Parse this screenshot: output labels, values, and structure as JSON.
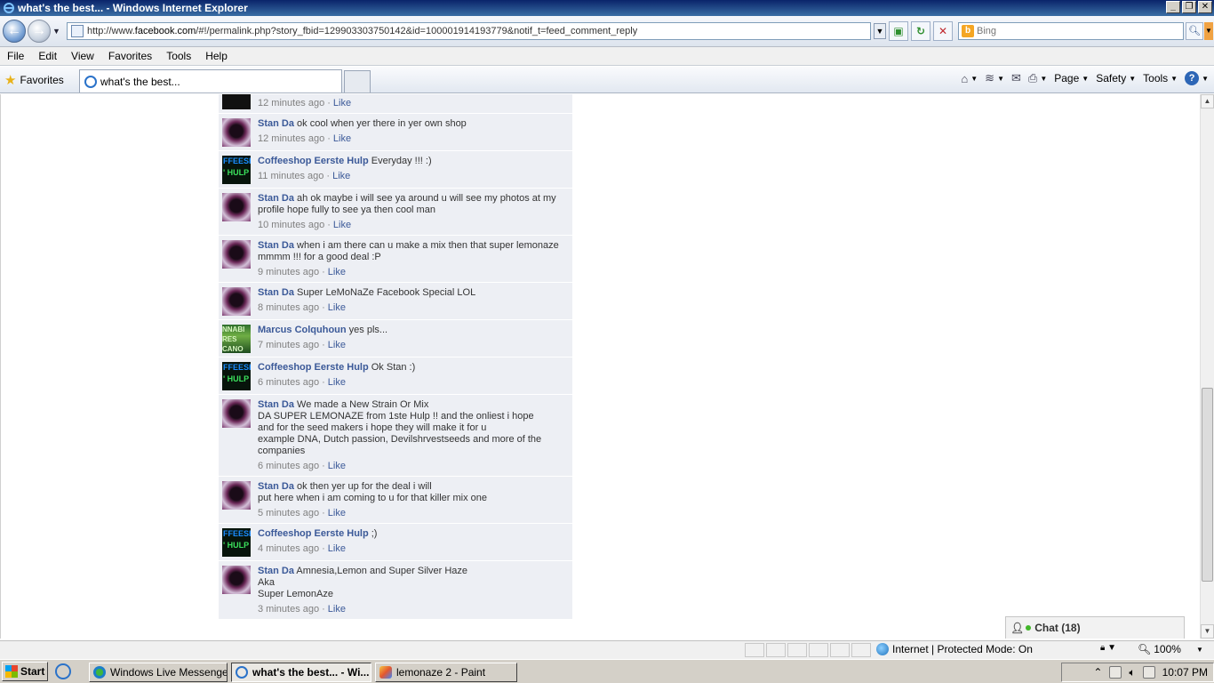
{
  "window": {
    "title": "what's the best... - Windows Internet Explorer",
    "btn_minimize": "_",
    "btn_restore": "❐",
    "btn_close": "✕"
  },
  "address": {
    "url_prefix": "http://www.",
    "url_domain": "facebook.com",
    "url_rest": "/#!/permalink.php?story_fbid=129903303750142&id=100001914193779&notif_t=feed_comment_reply",
    "search_placeholder": "Bing",
    "search_engine_badge": "b"
  },
  "menu": [
    "File",
    "Edit",
    "View",
    "Favorites",
    "Tools",
    "Help"
  ],
  "favbar": {
    "favorites_label": "Favorites",
    "tab_title": "what's the best...",
    "commands": {
      "page": "Page",
      "safety": "Safety",
      "tools": "Tools",
      "help": "?"
    }
  },
  "feed": {
    "top_meta": "12 minutes ago",
    "like_label": "Like",
    "dot": "·",
    "comments": [
      {
        "author": "Stan Da",
        "text": "ok cool when yer there in yer own shop",
        "time": "12 minutes ago",
        "avatar": "stan"
      },
      {
        "author": "Coffeeshop Eerste Hulp",
        "text": "Everyday !!! :)",
        "time": "11 minutes ago",
        "avatar": "coffee"
      },
      {
        "author": "Stan Da",
        "text": "ah ok maybe i will see ya around u will see my photos at my profile hope fully to see ya then cool man",
        "time": "10 minutes ago",
        "avatar": "stan"
      },
      {
        "author": "Stan Da",
        "text": "when i am there can u make a mix then that super lemonaze mmmm !!! for a good deal :P",
        "time": "9 minutes ago",
        "avatar": "stan"
      },
      {
        "author": "Stan Da",
        "text": "Super LeMoNaZe Facebook Special LOL",
        "time": "8 minutes ago",
        "avatar": "stan"
      },
      {
        "author": "Marcus Colquhoun",
        "text": "yes pls...",
        "time": "7 minutes ago",
        "avatar": "marcus"
      },
      {
        "author": "Coffeeshop Eerste Hulp",
        "text": "Ok Stan :)",
        "time": "6 minutes ago",
        "avatar": "coffee"
      },
      {
        "author": "Stan Da",
        "text": "We made a New Strain Or Mix\nDA SUPER LEMONAZE from 1ste Hulp !! and the onliest i hope\nand for the seed makers i hope they will make it for u\nexample DNA, Dutch passion, Devilshrvestseeds and more of the companies",
        "time": "6 minutes ago",
        "avatar": "stan"
      },
      {
        "author": "Stan Da",
        "text": "ok then yer up for the deal i will\nput here when i am coming to u for that killer mix one",
        "time": "5 minutes ago",
        "avatar": "stan"
      },
      {
        "author": "Coffeeshop Eerste Hulp",
        "text": ";)",
        "time": "4 minutes ago",
        "avatar": "coffee"
      },
      {
        "author": "Stan Da",
        "text": "Amnesia,Lemon and Super Silver Haze\nAka\nSuper LemonAze",
        "time": "3 minutes ago",
        "avatar": "stan"
      }
    ]
  },
  "avatar_text": {
    "coffee_top": "FFEESH",
    "coffee_bottom": "' HULP",
    "marcus_top": "NNABI",
    "marcus_bottom": "RES CANO"
  },
  "chat": {
    "label": "Chat (18)"
  },
  "status": {
    "zone": "Internet | Protected Mode: On",
    "zoom": "100%"
  },
  "taskbar": {
    "start": "Start",
    "buttons": [
      "Windows Live Messenger",
      "what's the best... - Wi...",
      "lemonaze 2 - Paint"
    ],
    "clock": "10:07 PM"
  }
}
